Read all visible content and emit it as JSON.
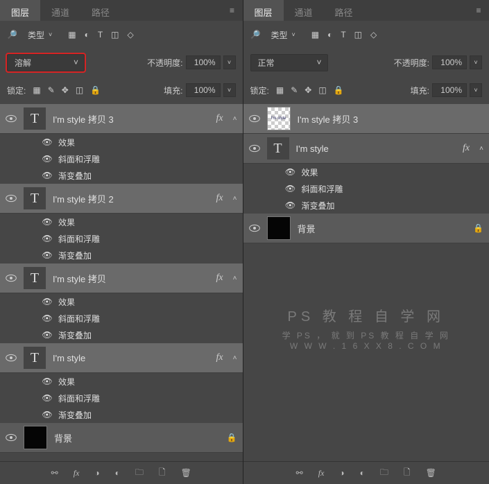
{
  "tabs": {
    "layers": "图层",
    "channels": "通道",
    "paths": "路径"
  },
  "filter": {
    "type_label": "类型"
  },
  "left": {
    "blend_mode": "溶解",
    "opacity_label": "不透明度:",
    "opacity_value": "100%",
    "lock_label": "锁定:",
    "fill_label": "填充:",
    "fill_value": "100%",
    "layers": [
      {
        "name": "I'm style 拷贝 3",
        "fx": true
      },
      {
        "name": "I'm style 拷贝 2",
        "fx": true
      },
      {
        "name": "I'm style 拷贝",
        "fx": true
      },
      {
        "name": "I'm style",
        "fx": true
      }
    ],
    "bg_name": "背景",
    "effects_label": "效果",
    "bevel_label": "斜面和浮雕",
    "gradient_label": "渐变叠加"
  },
  "right": {
    "blend_mode": "正常",
    "opacity_label": "不透明度:",
    "opacity_value": "100%",
    "lock_label": "锁定:",
    "fill_label": "填充:",
    "fill_value": "100%",
    "layer_raster": "I'm style 拷贝 3",
    "layer_text": "I'm style",
    "bg_name": "背景",
    "effects_label": "效果",
    "bevel_label": "斜面和浮雕",
    "gradient_label": "渐变叠加"
  },
  "watermark": {
    "title": "PS 教 程 自 学 网",
    "sub1": "学 PS ， 就 到 PS 教 程 自 学 网",
    "sub2": "W W W . 1 6 X X 8 . C O M"
  }
}
